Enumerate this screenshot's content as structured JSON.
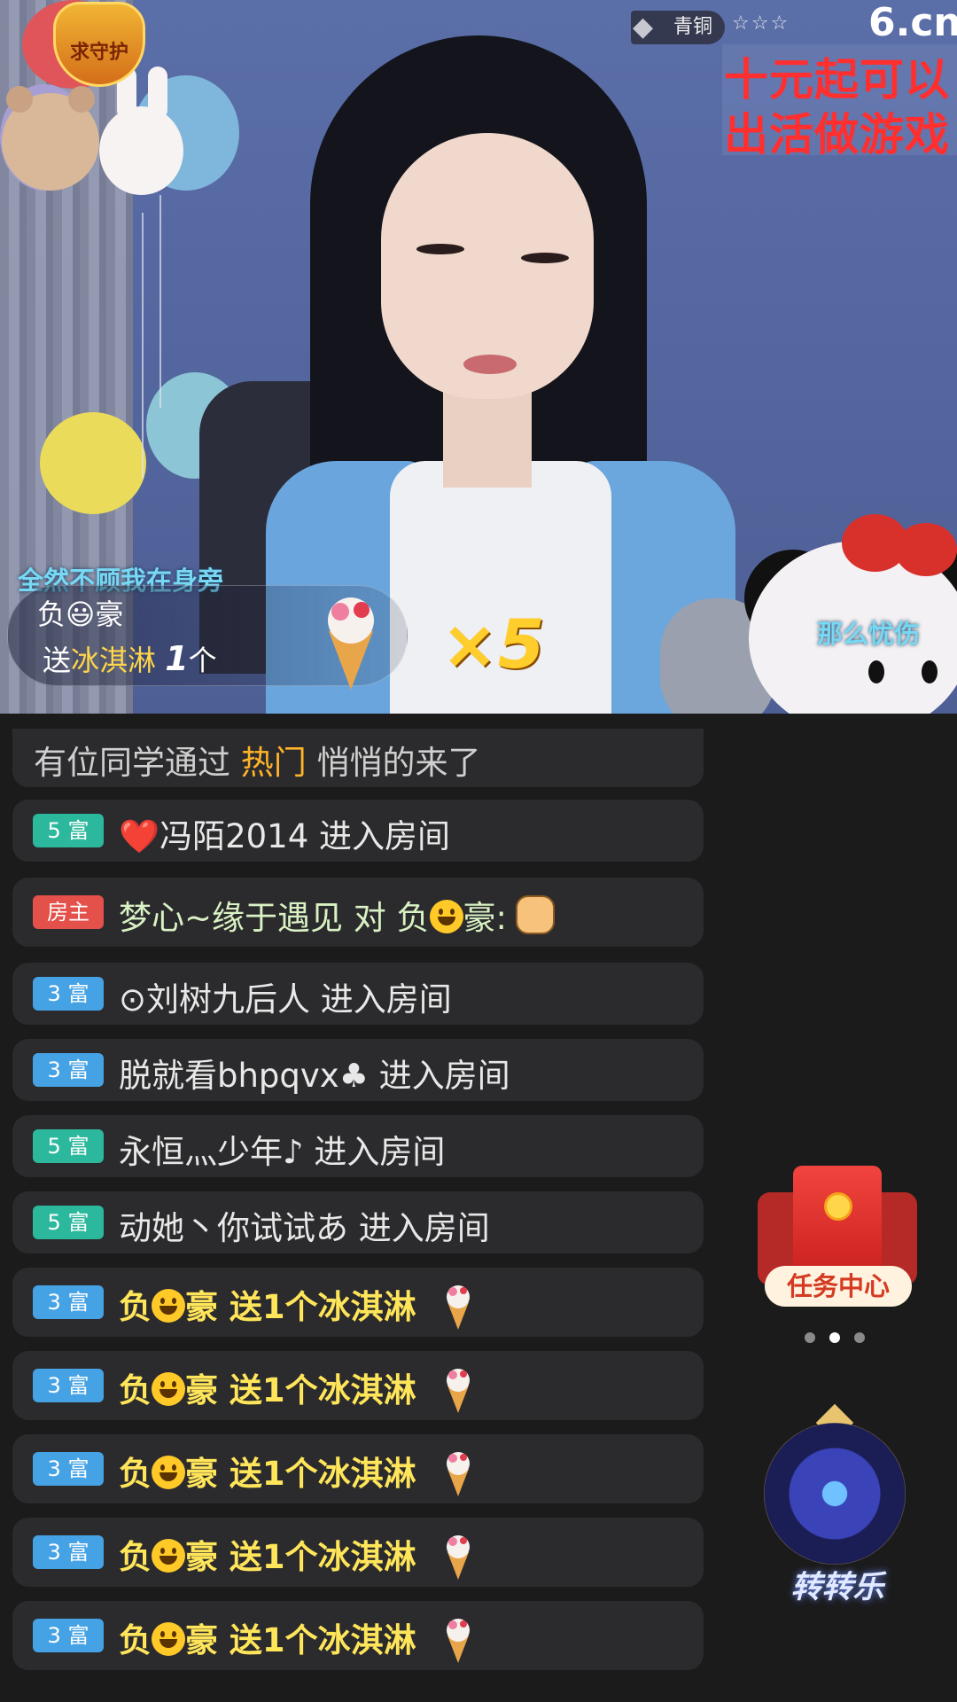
{
  "stream": {
    "guard_badge": "求守护",
    "rank": {
      "icon": "diamond-icon",
      "label": "青铜",
      "stars": "☆☆☆"
    },
    "logo": "6.cn",
    "notice_lines": [
      "十元起可以",
      "出活做游戏"
    ],
    "captions": {
      "left": "全然不顾我在身旁",
      "right": "那么忧伤"
    },
    "gift_banner": {
      "user": "负😃豪",
      "send_prefix": "送",
      "gift_name": "冰淇淋",
      "count": "1",
      "unit": "个",
      "combo": "×5"
    }
  },
  "chat": {
    "system_notice": {
      "prefix": "有位同学通过",
      "highlight": "热门",
      "suffix": "悄悄的来了"
    },
    "messages": [
      {
        "level": "5 富",
        "level_color": "green",
        "text": "❤️冯陌2014 进入房间"
      },
      {
        "level": "房主",
        "level_color": "red",
        "user": "梦心~缘于遇见 对 负",
        "target": "豪:",
        "emoji": "fist-icon"
      },
      {
        "level": "3 富",
        "level_color": "blue",
        "text": "⊙刘树九后人 进入房间"
      },
      {
        "level": "3 富",
        "level_color": "blue",
        "text": "脱就看bhpqvx♣ 进入房间"
      },
      {
        "level": "5 富",
        "level_color": "green",
        "text": "永恒灬少年♪ 进入房间"
      },
      {
        "level": "5 富",
        "level_color": "green",
        "text": "动她丶你试试あ 进入房间"
      },
      {
        "level": "3 富",
        "level_color": "blue",
        "user_a": "负",
        "user_b": "豪",
        "gift_text": "送1个冰淇淋"
      },
      {
        "level": "3 富",
        "level_color": "blue",
        "user_a": "负",
        "user_b": "豪",
        "gift_text": "送1个冰淇淋"
      },
      {
        "level": "3 富",
        "level_color": "blue",
        "user_a": "负",
        "user_b": "豪",
        "gift_text": "送1个冰淇淋"
      },
      {
        "level": "3 富",
        "level_color": "blue",
        "user_a": "负",
        "user_b": "豪",
        "gift_text": "送1个冰淇淋"
      },
      {
        "level": "3 富",
        "level_color": "blue",
        "user_a": "负",
        "user_b": "豪",
        "gift_text": "送1个冰淇淋"
      }
    ]
  },
  "widgets": {
    "task_center": "任务中心",
    "carousel_dots": 3,
    "carousel_active": 2,
    "wheel_game": "转转乐"
  },
  "colors": {
    "green_level": "#2bb89c",
    "blue_level": "#45a2e5",
    "red_level": "#e4504a",
    "gift_text": "#ffe55a",
    "highlight": "#ffb429"
  }
}
